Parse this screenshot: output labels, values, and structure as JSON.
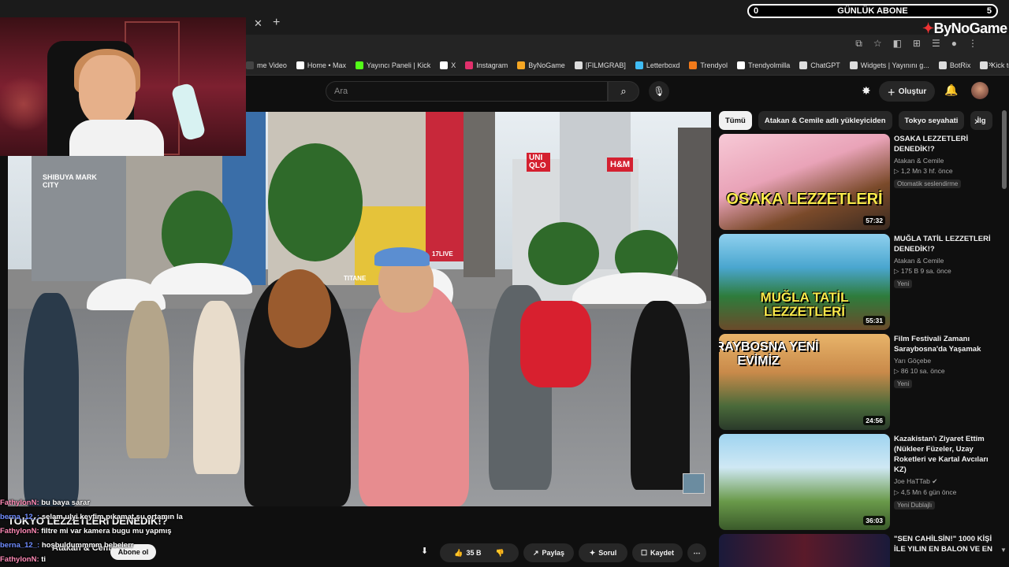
{
  "overlay": {
    "subscriber_goal_left": "0",
    "subscriber_goal_label": "GÜNLÜK ABONE",
    "subscriber_goal_right": "5",
    "brand": "ByNoGame"
  },
  "bookmarks": [
    {
      "label": "me Video",
      "color": "#444"
    },
    {
      "label": "Home • Max",
      "color": "#ffffff"
    },
    {
      "label": "Yayıncı Paneli | Kick",
      "color": "#53fc18"
    },
    {
      "label": "X",
      "color": "#ffffff"
    },
    {
      "label": "Instagram",
      "color": "#e1306c"
    },
    {
      "label": "ByNoGame",
      "color": "#f5a623"
    },
    {
      "label": "[FILMGRAB]",
      "color": "#dddddd"
    },
    {
      "label": "Letterboxd",
      "color": "#40bcf4"
    },
    {
      "label": "Trendyol",
      "color": "#f27a1a"
    },
    {
      "label": "Trendyolmilla",
      "color": "#ffffff"
    },
    {
      "label": "ChatGPT",
      "color": "#dddddd"
    },
    {
      "label": "Widgets | Yayınını g...",
      "color": "#dddddd"
    },
    {
      "label": "BotRix",
      "color": "#dddddd"
    },
    {
      "label": "Kick to Reels",
      "color": "#dddddd"
    }
  ],
  "search": {
    "placeholder": "Ara"
  },
  "header": {
    "create_label": "Oluştur"
  },
  "video": {
    "title": "TOKYO LEZZETLERİ DENEDİK!?",
    "channel": "Atakan & Cemile",
    "subscribe_label": "Abone ol",
    "like_count": "35 B",
    "share_label": "Paylaş",
    "clip_label": "Sorul",
    "save_label": "Kaydet",
    "signs": {
      "mark_city": "SHIBUYA MARK CITY",
      "uniqlo": "UNI QLO",
      "hm": "H&M",
      "live": "17LIVE",
      "titane": "TITANE"
    }
  },
  "chat": [
    {
      "name": "FathylonN:",
      "message": "bu baya sarar",
      "color": "pink"
    },
    {
      "name": "berna_12_:",
      "message": "selam ulyi keyfim pıkamat şu ortamın la",
      "color": "blue"
    },
    {
      "name": "FathylonN:",
      "message": "filtre mi var kamera bugu mu yapmış",
      "color": "pink"
    },
    {
      "name": "berna_12_:",
      "message": "hoşbuldummmm bebelerr",
      "color": "blue"
    },
    {
      "name": "FathylonN:",
      "message": "ti",
      "color": "pink"
    }
  ],
  "chips": [
    "Tümü",
    "Atakan & Cemile adlı yükleyiciden",
    "Tokyo seyahati",
    "İlg"
  ],
  "recommendations": [
    {
      "title": "OSAKA LEZZETLERİ DENEDİK!?",
      "channel": "Atakan & Cemile",
      "views": "▷ 1,2 Mn  3 hf. önce",
      "badge": "Otomatik seslendirme",
      "duration": "57:32",
      "thumb_text": "OSAKA LEZZETLERİ"
    },
    {
      "title": "MUĞLA TATİL LEZZETLERİ DENEDİK!?",
      "channel": "Atakan & Cemile",
      "views": "▷ 175 B  9 sa. önce",
      "badge": "Yeni",
      "duration": "55:31",
      "thumb_text": "MUĞLA TATİL LEZZETLERİ"
    },
    {
      "title": "Film Festivali Zamanı Saraybosna'da Yaşamak",
      "channel": "Yarı Göçebe",
      "views": "▷ 86  10 sa. önce",
      "badge": "Yeni",
      "duration": "24:56",
      "thumb_text": "SARAYBOSNA YENİ EVİMİZ"
    },
    {
      "title": "Kazakistan'ı Ziyaret Ettim (Nükleer Füzeler, Uzay Roketleri ve Kartal Avcıları KZ)",
      "channel": "Joe HaTTab ✔",
      "views": "▷ 4,5 Mn  6 gün önce",
      "badge": "Yeni   Dublajlı",
      "duration": "36:03",
      "thumb_text": ""
    },
    {
      "title": "\"SEN CAHİLSİN!\" 1000 KİŞİ İLE YILIN EN BALON VE EN",
      "channel": "",
      "views": "",
      "badge": "",
      "duration": "",
      "thumb_text": ""
    }
  ]
}
